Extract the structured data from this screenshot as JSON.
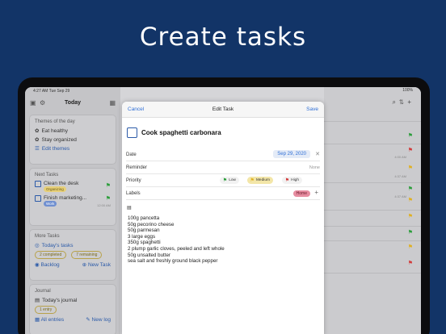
{
  "headline": "Create tasks",
  "status": {
    "time": "4:27 AM",
    "date": "Tue Sep 29",
    "right": "100%"
  },
  "sidebar": {
    "title": "Today",
    "themes": {
      "title": "Themes of the day",
      "items": [
        "Eat healthy",
        "Stay organized"
      ],
      "edit": "Edit themes"
    },
    "next": {
      "title": "Next Tasks",
      "items": [
        {
          "name": "Clean the desk",
          "chip": "Organizing"
        },
        {
          "name": "Finish marketing...",
          "chip": "Work",
          "time": "12:00 AM"
        }
      ]
    },
    "more": {
      "title": "More Tasks",
      "todays": "Today's tasks",
      "completed": "2 completed",
      "remaining": "7 remaining",
      "backlog": "Backlog",
      "new_task": "New Task"
    },
    "journal": {
      "title": "Journal",
      "todays": "Today's journal",
      "entries": "1 entry",
      "all": "All entries",
      "new_log": "New log"
    }
  },
  "modal": {
    "cancel": "Cancel",
    "title": "Edit Task",
    "save": "Save",
    "task_name": "Cook spaghetti carbonara",
    "date_label": "Date",
    "date_value": "Sep 29, 2020",
    "reminder_label": "Reminder",
    "reminder_value": "None",
    "priority_label": "Priority",
    "priority": {
      "low": "Low",
      "medium": "Medium",
      "high": "High"
    },
    "labels_label": "Labels",
    "label_chip": "Home",
    "notes": [
      "100g pancetta",
      "50g pecorino cheese",
      "50g parmesan",
      "3 large eggs",
      "350g spaghetti",
      "2 plump garlic cloves, peeled and left whole",
      "50g unsalted butter",
      "sea salt and freshly ground black pepper"
    ]
  },
  "rightlist": {
    "times": [
      "4:00 AM",
      "4:37 AM",
      "4:37 AM"
    ]
  },
  "colors": {
    "background": "#123467",
    "accent": "#2f6fd6"
  }
}
